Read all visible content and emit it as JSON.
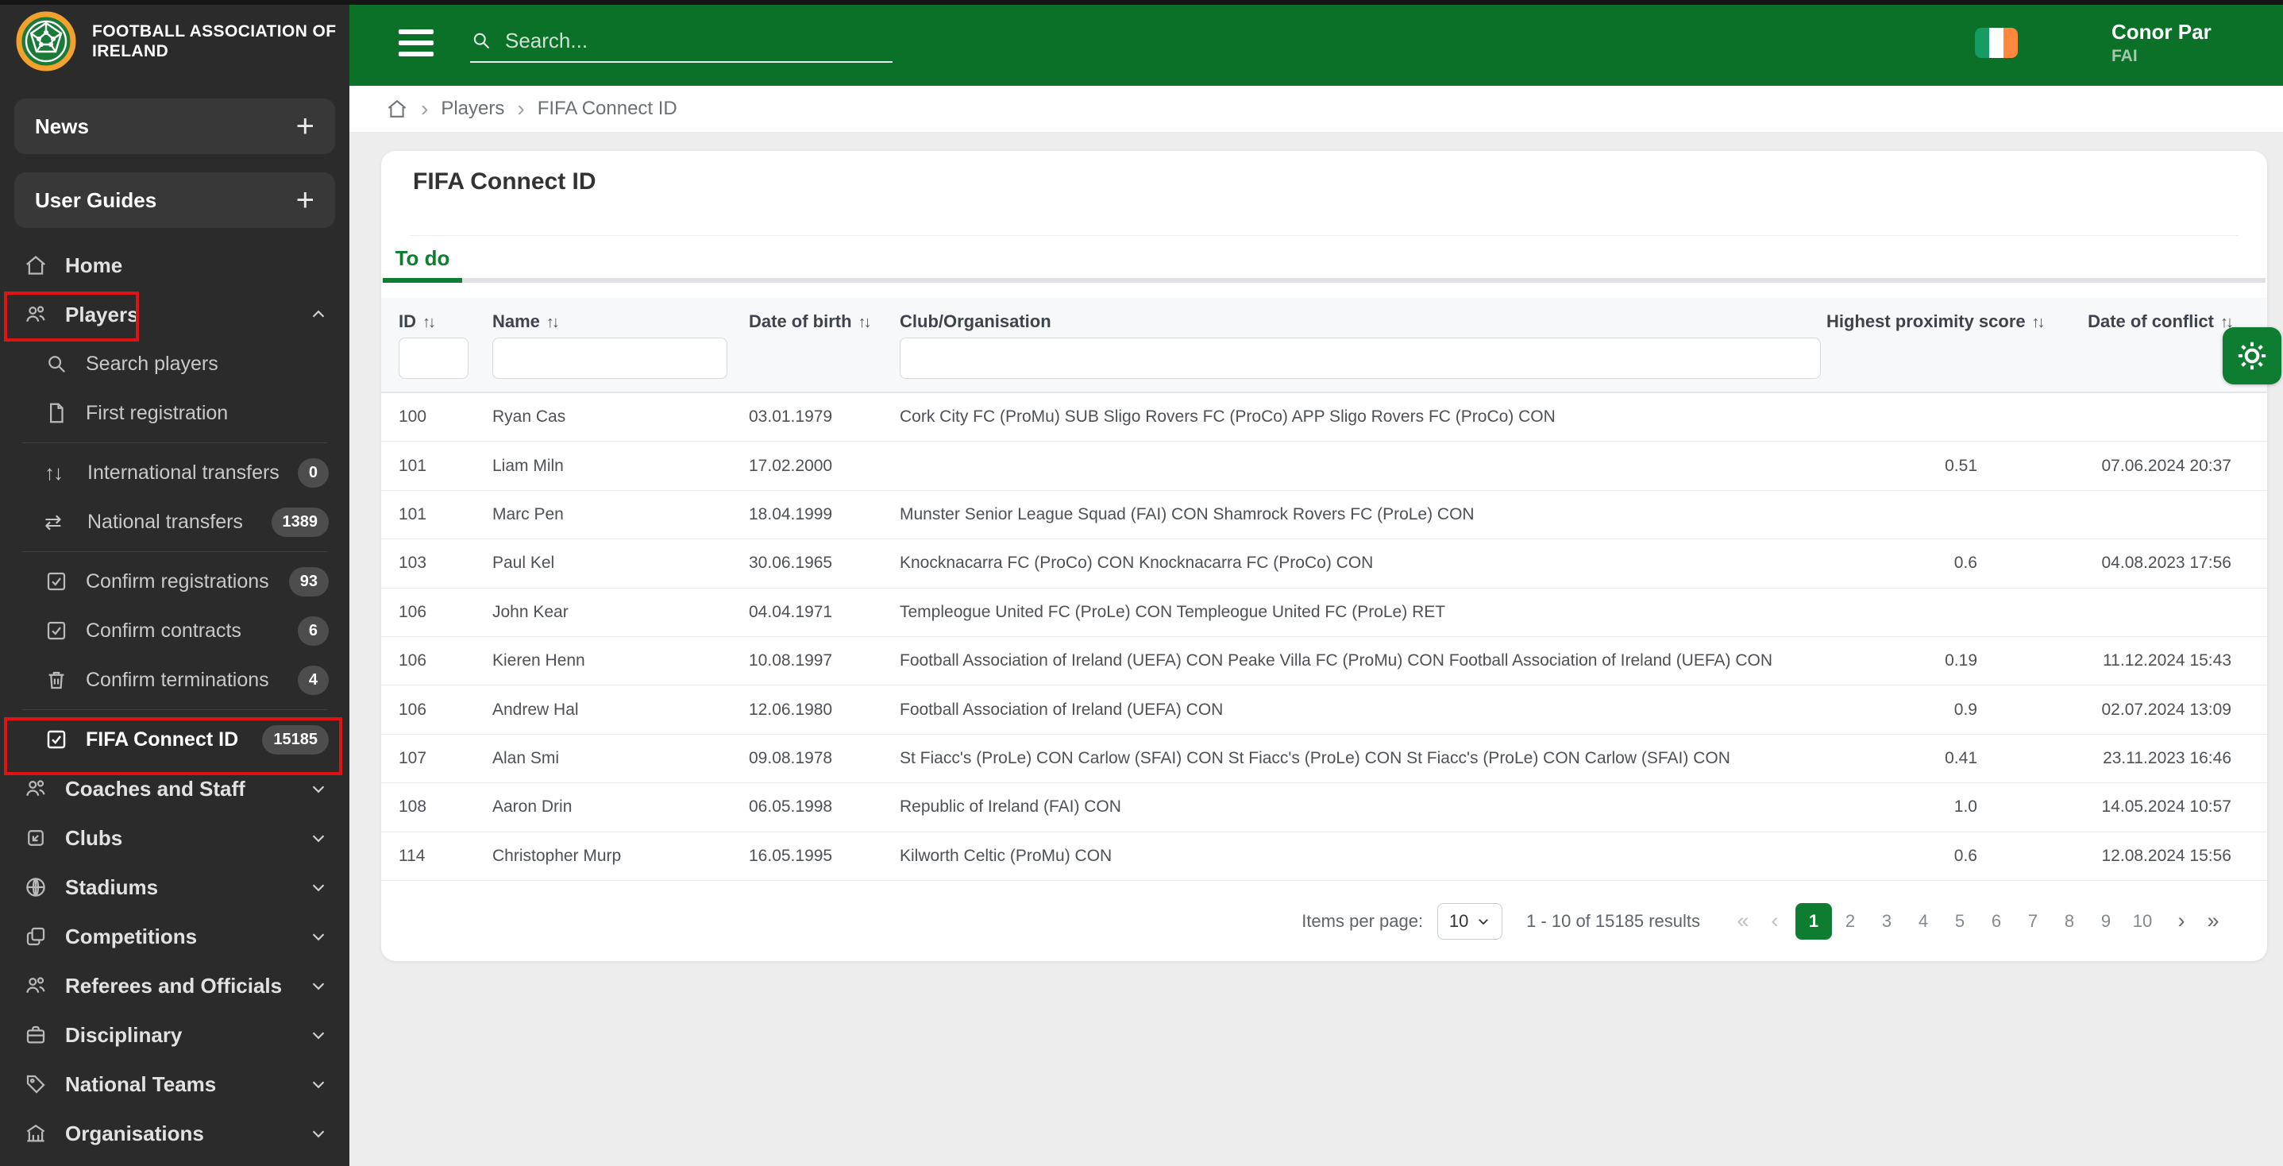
{
  "colors": {
    "topbar_green": "#0b7028",
    "accent_green": "#0e7c31",
    "sidebar_bg": "#2b2b2b",
    "annotation_red": "#e01212",
    "page_bg": "#ededee",
    "header_bg": "#f6f8fa",
    "badge_bg": "#4d4d4d"
  },
  "icons": {
    "sort": "↑↓",
    "plus": "+",
    "transfer_international": "↑↓",
    "transfer_national": "⇄",
    "breadcrumb_separator": "›",
    "page_first": "«",
    "page_prev": "‹",
    "page_next": "›",
    "page_last": "»"
  },
  "sidebar": {
    "logo_text": "FOOTBALL ASSOCIATION OF IRELAND",
    "buttons": [
      {
        "label": "News"
      },
      {
        "label": "User Guides"
      }
    ],
    "items": [
      {
        "label": "Home",
        "icon": "home-icon"
      },
      {
        "label": "Players",
        "icon": "players-icon",
        "annotated": true
      },
      {
        "label": "Search players",
        "icon": "search-icon"
      },
      {
        "label": "First registration",
        "icon": "document-icon"
      },
      {
        "label": "International transfers",
        "icon": "arrows-up-down-icon",
        "badge": "0"
      },
      {
        "label": "National transfers",
        "icon": "arrows-left-right-icon",
        "badge": "1389"
      },
      {
        "label": "Confirm registrations",
        "icon": "checkbox-icon",
        "badge": "93"
      },
      {
        "label": "Confirm contracts",
        "icon": "checkbox-icon",
        "badge": "6"
      },
      {
        "label": "Confirm terminations",
        "icon": "trash-icon",
        "badge": "4"
      },
      {
        "label": "FIFA Connect ID",
        "icon": "checkbox-icon",
        "badge": "15185",
        "active": true,
        "annotated": true
      },
      {
        "label": "Coaches and Staff",
        "icon": "people-icon"
      },
      {
        "label": "Clubs",
        "icon": "club-icon"
      },
      {
        "label": "Stadiums",
        "icon": "globe-icon"
      },
      {
        "label": "Competitions",
        "icon": "copy-icon"
      },
      {
        "label": "Referees and Officials",
        "icon": "people-icon"
      },
      {
        "label": "Disciplinary",
        "icon": "briefcase-icon"
      },
      {
        "label": "National Teams",
        "icon": "tag-icon"
      },
      {
        "label": "Organisations",
        "icon": "bank-icon"
      }
    ]
  },
  "topbar": {
    "search_placeholder": "Search...",
    "user_name": "Conor Par",
    "user_org": "FAI"
  },
  "breadcrumb": [
    "Players",
    "FIFA Connect ID"
  ],
  "page": {
    "title": "FIFA Connect ID",
    "active_tab": "To do"
  },
  "table": {
    "columns": [
      {
        "label": "ID",
        "sortable": true
      },
      {
        "label": "Name",
        "sortable": true
      },
      {
        "label": "Date of birth",
        "sortable": true
      },
      {
        "label": "Club/Organisation",
        "sortable": false
      },
      {
        "label": "Highest proximity score",
        "sortable": true
      },
      {
        "label": "Date of conflict",
        "sortable": true
      }
    ],
    "rows": [
      {
        "id": "100",
        "name": "Ryan Cas",
        "dob": "03.01.1979",
        "club": "Cork City FC (ProMu) SUB Sligo Rovers FC (ProCo) APP Sligo Rovers FC (ProCo) CON",
        "score": "",
        "conflict": ""
      },
      {
        "id": "101",
        "name": "Liam Miln",
        "dob": "17.02.2000",
        "club": "",
        "score": "0.51",
        "conflict": "07.06.2024 20:37"
      },
      {
        "id": "101",
        "name": "Marc Pen",
        "dob": "18.04.1999",
        "club": "Munster Senior League Squad (FAI) CON Shamrock Rovers FC (ProLe) CON",
        "score": "",
        "conflict": ""
      },
      {
        "id": "103",
        "name": "Paul Kel",
        "dob": "30.06.1965",
        "club": "Knocknacarra FC (ProCo) CON Knocknacarra FC (ProCo) CON",
        "score": "0.6",
        "conflict": "04.08.2023 17:56"
      },
      {
        "id": "106",
        "name": "John Kear",
        "dob": "04.04.1971",
        "club": "Templeogue United FC (ProLe) CON Templeogue United FC (ProLe) RET",
        "score": "",
        "conflict": ""
      },
      {
        "id": "106",
        "name": "Kieren Henn",
        "dob": "10.08.1997",
        "club": "Football Association of Ireland (UEFA) CON Peake Villa FC (ProMu) CON Football Association of Ireland (UEFA) CON",
        "score": "0.19",
        "conflict": "11.12.2024 15:43"
      },
      {
        "id": "106",
        "name": "Andrew Hal",
        "dob": "12.06.1980",
        "club": "Football Association of Ireland (UEFA) CON",
        "score": "0.9",
        "conflict": "02.07.2024 13:09"
      },
      {
        "id": "107",
        "name": "Alan Smi",
        "dob": "09.08.1978",
        "club": "St Fiacc's (ProLe) CON Carlow (SFAI) CON St Fiacc's (ProLe) CON St Fiacc's (ProLe) CON Carlow (SFAI) CON",
        "score": "0.41",
        "conflict": "23.11.2023 16:46"
      },
      {
        "id": "108",
        "name": "Aaron Drin",
        "dob": "06.05.1998",
        "club": "Republic of Ireland (FAI) CON",
        "score": "1.0",
        "conflict": "14.05.2024 10:57"
      },
      {
        "id": "114",
        "name": "Christopher Murp",
        "dob": "16.05.1995",
        "club": "Kilworth Celtic (ProMu) CON",
        "score": "0.6",
        "conflict": "12.08.2024 15:56"
      }
    ]
  },
  "pagination": {
    "items_per_page_label": "Items per page:",
    "items_per_page": "10",
    "results_text": "1 - 10 of 15185 results",
    "pages": [
      "1",
      "2",
      "3",
      "4",
      "5",
      "6",
      "7",
      "8",
      "9",
      "10"
    ],
    "active_page": "1"
  }
}
